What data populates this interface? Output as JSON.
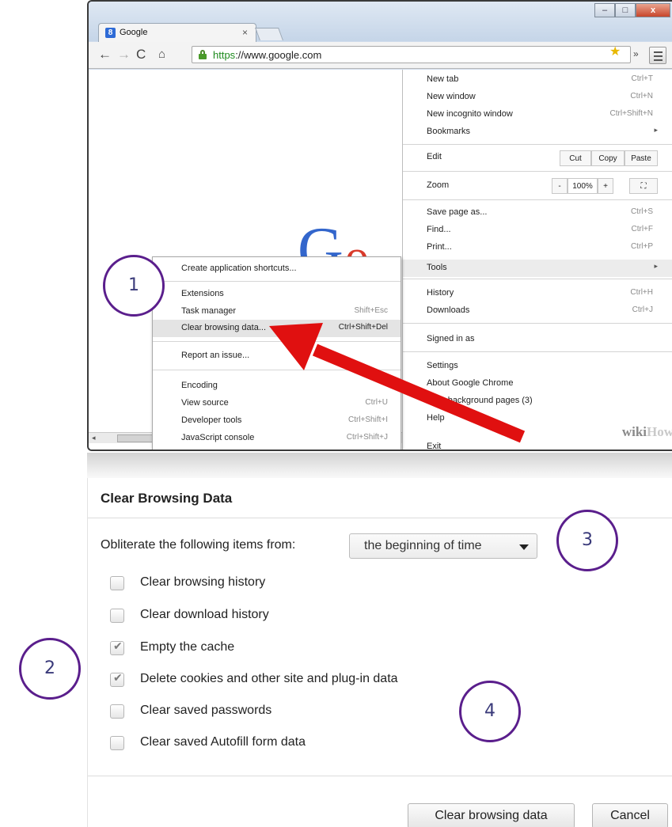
{
  "browser": {
    "tab_title": "Google",
    "tab_close": "×",
    "favicon_letter": "8",
    "url_https": "https",
    "url_rest": "://www.google.com",
    "window_controls": [
      "–",
      "□",
      "x"
    ],
    "nav_icons": [
      "back-icon",
      "forward-icon",
      "reload-icon",
      "home-icon"
    ],
    "overflow_label": "»",
    "page_logo_letters": [
      "G",
      "o"
    ],
    "watermark_a": "wiki",
    "watermark_b": "How"
  },
  "chrome_menu": {
    "new_tab": "New tab",
    "new_tab_sc": "Ctrl+T",
    "new_window": "New window",
    "new_window_sc": "Ctrl+N",
    "incognito": "New incognito window",
    "incognito_sc": "Ctrl+Shift+N",
    "bookmarks": "Bookmarks",
    "edit": "Edit",
    "cut": "Cut",
    "copy": "Copy",
    "paste": "Paste",
    "zoom": "Zoom",
    "zoom_minus": "-",
    "zoom_value": "100%",
    "zoom_plus": "+",
    "save_page": "Save page as...",
    "save_page_sc": "Ctrl+S",
    "find": "Find...",
    "find_sc": "Ctrl+F",
    "print": "Print...",
    "print_sc": "Ctrl+P",
    "tools": "Tools",
    "history": "History",
    "history_sc": "Ctrl+H",
    "downloads": "Downloads",
    "downloads_sc": "Ctrl+J",
    "signed_in": "Signed in as",
    "settings": "Settings",
    "about": "About Google Chrome",
    "background_pages": "View background pages (3)",
    "help": "Help",
    "exit": "Exit"
  },
  "tools_menu": {
    "create_shortcuts": "Create application shortcuts...",
    "extensions": "Extensions",
    "task_manager": "Task manager",
    "task_manager_sc": "Shift+Esc",
    "clear_data": "Clear browsing data...",
    "clear_data_sc": "Ctrl+Shift+Del",
    "report_issue": "Report an issue...",
    "encoding": "Encoding",
    "view_source": "View source",
    "view_source_sc": "Ctrl+U",
    "dev_tools": "Developer tools",
    "dev_tools_sc": "Ctrl+Shift+I",
    "js_console": "JavaScript console",
    "js_console_sc": "Ctrl+Shift+J"
  },
  "dialog": {
    "title": "Clear Browsing Data",
    "time_label": "Obliterate the following items from:",
    "time_value": "the beginning of time",
    "options": [
      {
        "label": "Clear browsing history",
        "checked": false
      },
      {
        "label": "Clear download history",
        "checked": false
      },
      {
        "label": "Empty the cache",
        "checked": true
      },
      {
        "label": "Delete cookies and other site and plug-in data",
        "checked": true
      },
      {
        "label": "Clear saved passwords",
        "checked": false
      },
      {
        "label": "Clear saved Autofill form data",
        "checked": false
      }
    ],
    "clear_button": "Clear browsing data",
    "cancel_button": "Cancel"
  },
  "callouts": [
    "1",
    "2",
    "3",
    "4"
  ],
  "colors": {
    "callout_ring": "#5a1e8c",
    "arrow": "#e01010",
    "https_green": "#1d8a1d"
  }
}
